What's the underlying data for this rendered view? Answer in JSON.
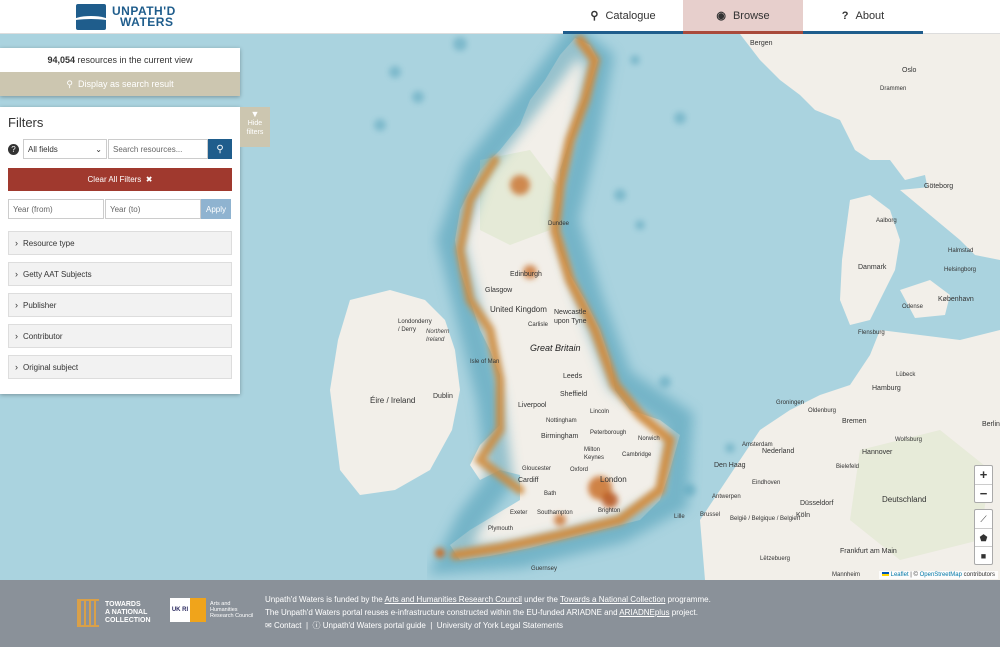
{
  "header": {
    "logo_line1": "UNPATH'D",
    "logo_line2": "WATERS",
    "nav": [
      {
        "label": "Catalogue",
        "icon": "search-icon"
      },
      {
        "label": "Browse",
        "icon": "globe-icon"
      },
      {
        "label": "About",
        "icon": "question-icon"
      }
    ]
  },
  "results": {
    "count": "94,054",
    "count_suffix": "resources in the current view",
    "display_button": "Display as search result"
  },
  "filters": {
    "title": "Filters",
    "hide_label_1": "Hide",
    "hide_label_2": "filters",
    "field_select": "All fields",
    "search_placeholder": "Search resources...",
    "clear_button": "Clear All Filters",
    "year_from_placeholder": "Year (from)",
    "year_to_placeholder": "Year (to)",
    "apply_button": "Apply",
    "facets": [
      "Resource type",
      "Getty AAT Subjects",
      "Publisher",
      "Contributor",
      "Original subject"
    ]
  },
  "map": {
    "labels": {
      "bergen": "Bergen",
      "oslo": "Oslo",
      "drammen": "Drammen",
      "goteborg": "Göteborg",
      "aalborg": "Aalborg",
      "danmark": "Danmark",
      "kobenhavn": "København",
      "helsingborg": "Helsingborg",
      "halmstad": "Halmstad",
      "odense": "Odense",
      "flensburg": "Flensburg",
      "lubeck": "Lübeck",
      "hamburg": "Hamburg",
      "bremen": "Bremen",
      "groningen": "Groningen",
      "oldenburg": "Oldenburg",
      "berlin": "Berlin",
      "hannover": "Hannover",
      "wolfsburg": "Wolfsburg",
      "bielefeld": "Bielefeld",
      "deutschland": "Deutschland",
      "dusseldorf": "Düsseldorf",
      "koln": "Köln",
      "frankfurt": "Frankfurt am Main",
      "luxembourg": "Lëtzebuerg",
      "denhaag": "Den Haag",
      "nederland": "Nederland",
      "amsterdam": "Amsterdam",
      "eindhoven": "Eindhoven",
      "antwerpen": "Antwerpen",
      "belgie": "België / Belgique / Belgien",
      "brussel": "Brussel",
      "lille": "Lille",
      "great_britain": "Great Britain",
      "united_kingdom": "United Kingdom",
      "dundee": "Dundee",
      "edinburgh": "Edinburgh",
      "glasgow": "Glasgow",
      "newcastle": "Newcastle upon Tyne",
      "carlisle": "Carlisle",
      "leeds": "Leeds",
      "sheffield": "Sheffield",
      "liverpool": "Liverpool",
      "lincoln": "Lincoln",
      "nottingham": "Nottingham",
      "norwich": "Norwich",
      "peterborough": "Peterborough",
      "birmingham": "Birmingham",
      "cambridge": "Cambridge",
      "milton_keynes": "Milton Keynes",
      "gloucester": "Gloucester",
      "oxford": "Oxford",
      "london": "London",
      "cardiff": "Cardiff",
      "bath": "Bath",
      "southampton": "Southampton",
      "brighton": "Brighton",
      "exeter": "Exeter",
      "plymouth": "Plymouth",
      "londonderry": "Londonderry / Derry",
      "dublin": "Dublin",
      "eire": "Éire / Ireland",
      "northern_ireland": "Northern Ireland",
      "isle_of_man": "Isle of Man",
      "guernsey": "Guernsey",
      "mannheim": "Mannheim"
    }
  },
  "attribution": {
    "leaflet": "Leaflet",
    "separator": " | © ",
    "osm": "OpenStreetMap",
    "contributors": " contributors"
  },
  "controls": {
    "zoom_in": "+",
    "zoom_out": "−"
  },
  "footer": {
    "tnc_line1": "TOWARDS",
    "tnc_line2": "A NATIONAL",
    "tnc_line3": "COLLECTION",
    "ukri_mark": "UK RI",
    "ukri_line1": "Arts and",
    "ukri_line2": "Humanities",
    "ukri_line3": "Research Council",
    "line1_a": "Unpath'd Waters is funded by the ",
    "line1_link1": "Arts and Humanities Research Council",
    "line1_b": " under the ",
    "line1_link2": "Towards a National Collection",
    "line1_c": " programme.",
    "line2_a": "The Unpath'd Waters portal reuses e-infrastructure constructed within the EU-funded ARIADNE and ",
    "line2_link": "ARIADNEplus",
    "line2_b": " project.",
    "contact": "Contact",
    "guide": "Unpath'd Waters portal guide",
    "legal": "University of York Legal Statements"
  }
}
